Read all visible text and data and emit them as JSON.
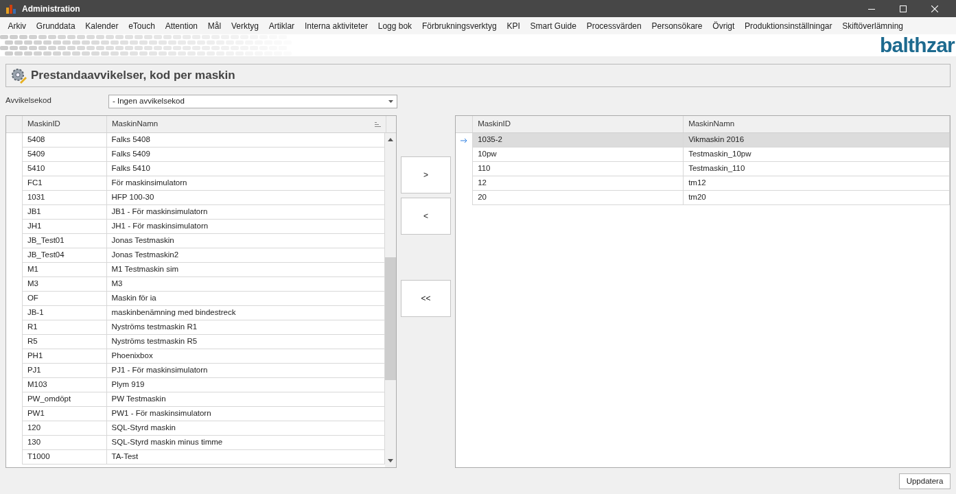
{
  "window": {
    "title": "Administration"
  },
  "menu": [
    "Arkiv",
    "Grunddata",
    "Kalender",
    "eTouch",
    "Attention",
    "Mål",
    "Verktyg",
    "Artiklar",
    "Interna aktiviteter",
    "Logg bok",
    "Förbrukningsverktyg",
    "KPI",
    "Smart Guide",
    "Processvärden",
    "Personsökare",
    "Övrigt",
    "Produktionsinställningar",
    "Skiftöverlämning"
  ],
  "logo": "balthzar",
  "page_title": "Prestandaavvikelser, kod per maskin",
  "filter": {
    "label": "Avvikelsekod",
    "value": "- Ingen avvikelsekod"
  },
  "available_table": {
    "columns": [
      "MaskinID",
      "MaskinNamn"
    ],
    "rows": [
      {
        "cells": [
          "5408",
          "Falks 5408"
        ],
        "selected": false
      },
      {
        "cells": [
          "5409",
          "Falks 5409"
        ],
        "selected": false
      },
      {
        "cells": [
          "5410",
          "Falks 5410"
        ],
        "selected": false
      },
      {
        "cells": [
          "FC1",
          "För maskinsimulatorn"
        ],
        "selected": false
      },
      {
        "cells": [
          "1031",
          "HFP 100-30"
        ],
        "selected": false
      },
      {
        "cells": [
          "JB1",
          "JB1 - För maskinsimulatorn"
        ],
        "selected": false
      },
      {
        "cells": [
          "JH1",
          "JH1 - För maskinsimulatorn"
        ],
        "selected": false
      },
      {
        "cells": [
          "JB_Test01",
          "Jonas Testmaskin"
        ],
        "selected": false
      },
      {
        "cells": [
          "JB_Test04",
          "Jonas Testmaskin2"
        ],
        "selected": false
      },
      {
        "cells": [
          "M1",
          "M1 Testmaskin sim"
        ],
        "selected": false
      },
      {
        "cells": [
          "M3",
          "M3"
        ],
        "selected": false
      },
      {
        "cells": [
          "OF",
          "Maskin för ia"
        ],
        "selected": false
      },
      {
        "cells": [
          "JB-1",
          "maskinbenämning med bindestreck"
        ],
        "selected": false
      },
      {
        "cells": [
          "R1",
          "Nyströms testmaskin R1"
        ],
        "selected": false
      },
      {
        "cells": [
          "R5",
          "Nyströms testmaskin R5"
        ],
        "selected": false
      },
      {
        "cells": [
          "PH1",
          "Phoenixbox"
        ],
        "selected": false
      },
      {
        "cells": [
          "PJ1",
          "PJ1 - För maskinsimulatorn"
        ],
        "selected": false
      },
      {
        "cells": [
          "M103",
          "Plym 919"
        ],
        "selected": false
      },
      {
        "cells": [
          "PW_omdöpt",
          "PW Testmaskin"
        ],
        "selected": false
      },
      {
        "cells": [
          "PW1",
          "PW1 - För maskinsimulatorn"
        ],
        "selected": false
      },
      {
        "cells": [
          "120",
          "SQL-Styrd maskin"
        ],
        "selected": false
      },
      {
        "cells": [
          "130",
          "SQL-Styrd maskin minus timme"
        ],
        "selected": false
      },
      {
        "cells": [
          "T1000",
          "TA-Test"
        ],
        "selected": false
      }
    ]
  },
  "transfer_buttons": [
    ">",
    "<",
    "<<"
  ],
  "selected_table": {
    "columns": [
      "MaskinID",
      "MaskinNamn"
    ],
    "rows": [
      {
        "cells": [
          "1035-2",
          "Vikmaskin 2016"
        ],
        "selected": true
      },
      {
        "cells": [
          "10pw",
          "Testmaskin_10pw"
        ],
        "selected": false
      },
      {
        "cells": [
          "110",
          "Testmaskin_110"
        ],
        "selected": false
      },
      {
        "cells": [
          "12",
          "tm12"
        ],
        "selected": false
      },
      {
        "cells": [
          "20",
          "tm20"
        ],
        "selected": false
      }
    ]
  },
  "update_button": "Uppdatera"
}
